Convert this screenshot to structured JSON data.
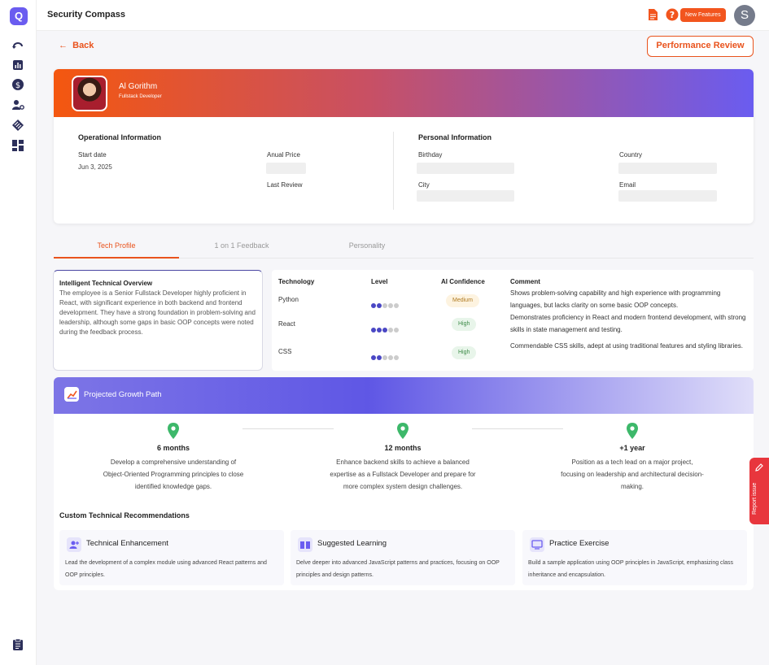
{
  "app": {
    "logo_letter": "Q",
    "title": "Security Compass",
    "new_features": "New Features",
    "user_initial": "S"
  },
  "nav": {
    "back": "Back",
    "performance_review": "Performance Review"
  },
  "profile": {
    "name": "Al Gorithm",
    "role": "Fullstack Developer"
  },
  "operational": {
    "title": "Operational Information",
    "start_date_label": "Start date",
    "start_date": "Jun 3, 2025",
    "annual_price_label": "Anual Price",
    "last_review_label": "Last Review"
  },
  "personal": {
    "title": "Personal Information",
    "birthday_label": "Birthday",
    "country_label": "Country",
    "city_label": "City",
    "email_label": "Email"
  },
  "tabs": [
    "Tech Profile",
    "1 on 1 Feedback",
    "Personality"
  ],
  "overview": {
    "title": "Intelligent Technical Overview",
    "text": "The employee is a Senior Fullstack Developer highly proficient in React, with significant experience in both backend and frontend development. They have a strong foundation in problem-solving and leadership, although some gaps in basic OOP concepts were noted during the feedback process."
  },
  "tech_table": {
    "headers": [
      "Technology",
      "Level",
      "AI Confidence",
      "Comment"
    ],
    "rows": [
      {
        "tech": "Python",
        "level": 2,
        "confidence": "Medium",
        "comment": "Shows problem-solving capability and high experience with programming languages, but lacks clarity on some basic OOP concepts."
      },
      {
        "tech": "React",
        "level": 3,
        "confidence": "High",
        "comment": "Demonstrates proficiency in React and modern frontend development, with strong skills in state management and testing."
      },
      {
        "tech": "CSS",
        "level": 2,
        "confidence": "High",
        "comment": "Commendable CSS skills, adept at using traditional features and styling libraries."
      }
    ]
  },
  "growth": {
    "title": "Projected Growth Path",
    "milestones": [
      {
        "period": "6 months",
        "text": "Develop a comprehensive understanding of Object-Oriented Programming principles to close identified knowledge gaps."
      },
      {
        "period": "12 months",
        "text": "Enhance backend skills to achieve a balanced expertise as a Fullstack Developer and prepare for more complex system design challenges."
      },
      {
        "period": "+1 year",
        "text": "Position as a tech lead on a major project, focusing on leadership and architectural decision-making."
      }
    ],
    "rec_title": "Custom Technical Recommendations",
    "recs": [
      {
        "title": "Technical Enhancement",
        "text": "Lead the development of a complex module using advanced React patterns and OOP principles."
      },
      {
        "title": "Suggested Learning",
        "text": "Delve deeper into advanced JavaScript patterns and practices, focusing on OOP principles and design patterns."
      },
      {
        "title": "Practice Exercise",
        "text": "Build a sample application using OOP principles in JavaScript, emphasizing class inheritance and encapsulation."
      }
    ]
  },
  "report_issue": "Report issue",
  "colors": {
    "accent": "#e9531d",
    "brand": "#6a5cf0",
    "dots": "#4a47c4"
  }
}
